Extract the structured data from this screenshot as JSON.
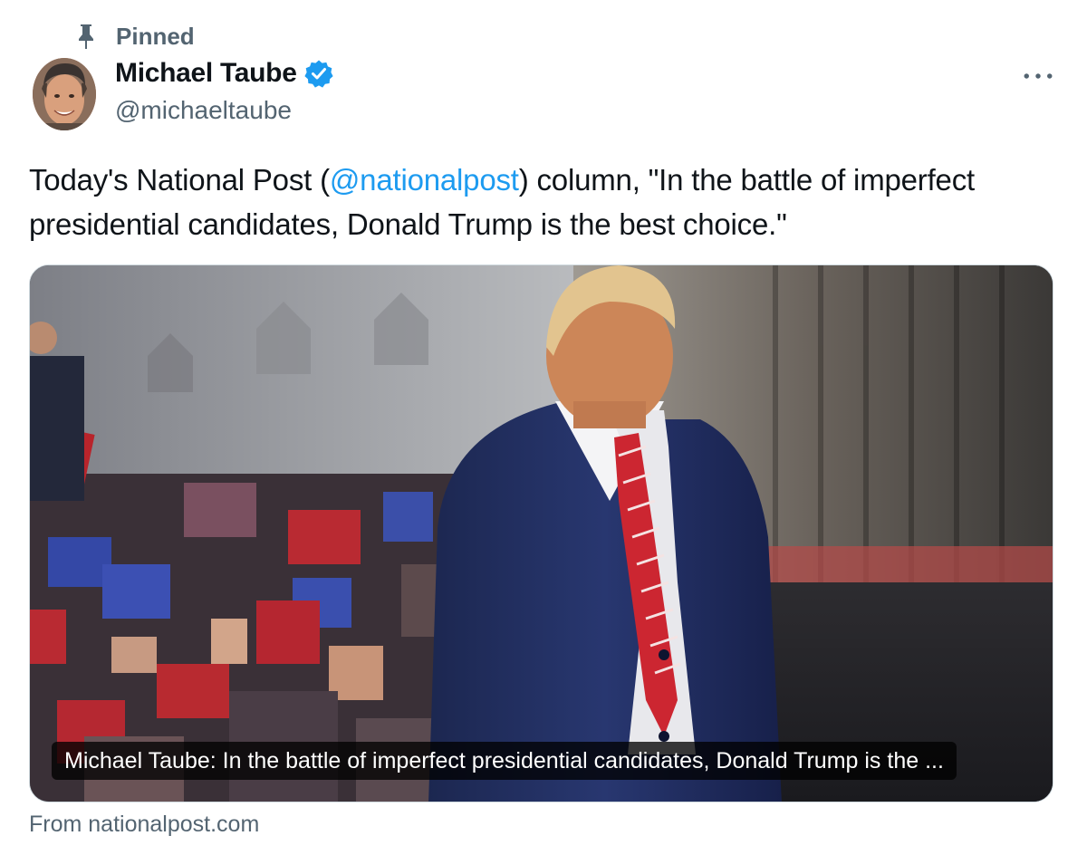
{
  "pinned": {
    "label": "Pinned",
    "icon": "pin-icon"
  },
  "author": {
    "name": "Michael Taube",
    "handle": "@michaeltaube",
    "verified_icon": "verified-badge-icon",
    "verified_color": "#1d9bf0"
  },
  "more_icon": "more-horizontal-icon",
  "tweet": {
    "text_before": "Today's National Post (",
    "mention": "@nationalpost",
    "text_after": ") column, \"In the battle of imperfect presidential candidates, Donald Trump is the best choice.\""
  },
  "card": {
    "title": "Michael Taube: In the battle of imperfect presidential candidates, Donald Trump is the ...",
    "source": "From nationalpost.com"
  },
  "colors": {
    "accent": "#1d9bf0",
    "secondary_text": "#536471",
    "primary_text": "#0f1419",
    "border": "#cfd9de"
  }
}
